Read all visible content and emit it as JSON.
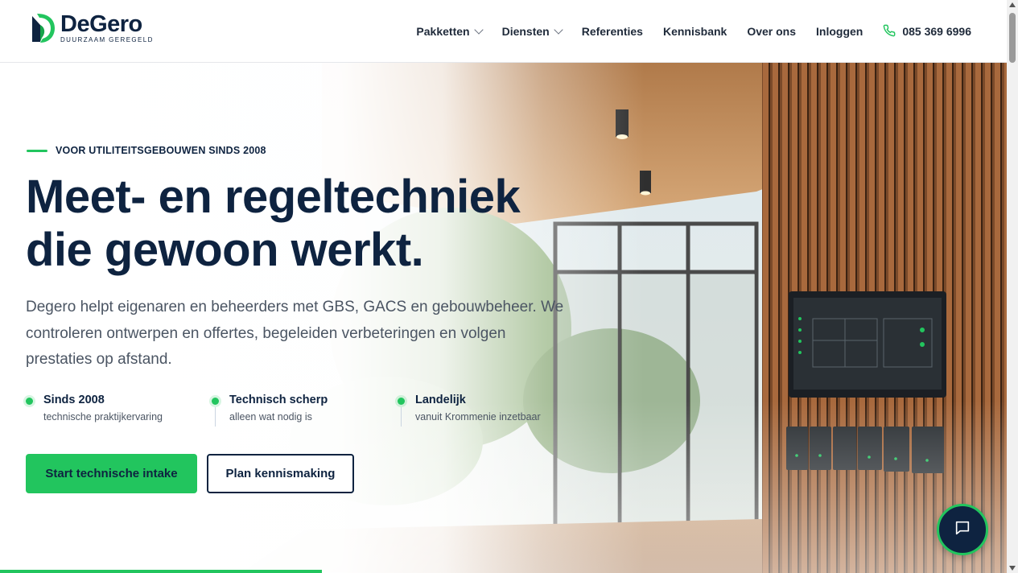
{
  "brand": {
    "name": "DeGero",
    "tagline": "DUURZAAM GEREGELD",
    "accent_color": "#22c55e",
    "navy_color": "#0e2340"
  },
  "nav": {
    "items": [
      {
        "label": "Pakketten",
        "dropdown": true
      },
      {
        "label": "Diensten",
        "dropdown": true
      },
      {
        "label": "Referenties",
        "dropdown": false
      },
      {
        "label": "Kennisbank",
        "dropdown": false
      },
      {
        "label": "Over ons",
        "dropdown": false
      },
      {
        "label": "Inloggen",
        "dropdown": false
      }
    ],
    "phone": "085 369 6996",
    "phone_icon": "phone-icon"
  },
  "hero": {
    "eyebrow": "VOOR UTILITEITSGEBOUWEN SINDS 2008",
    "headline_line1": "Meet- en regeltechniek",
    "headline_line2": "die gewoon werkt.",
    "intro": "Degero helpt eigenaren en beheerders met GBS, GACS en gebouwbeheer. We controleren ontwerpen en offertes, begeleiden verbeteringen en volgen prestaties op afstand.",
    "features": [
      {
        "title": "Sinds 2008",
        "subtitle": "technische praktijkervaring"
      },
      {
        "title": "Technisch scherp",
        "subtitle": "alleen wat nodig is"
      },
      {
        "title": "Landelijk",
        "subtitle": "vanuit Krommenie inzetbaar"
      }
    ],
    "primary_cta": "Start technische intake",
    "secondary_cta": "Plan kennismaking"
  },
  "chat": {
    "icon": "chat-bubble-icon"
  }
}
